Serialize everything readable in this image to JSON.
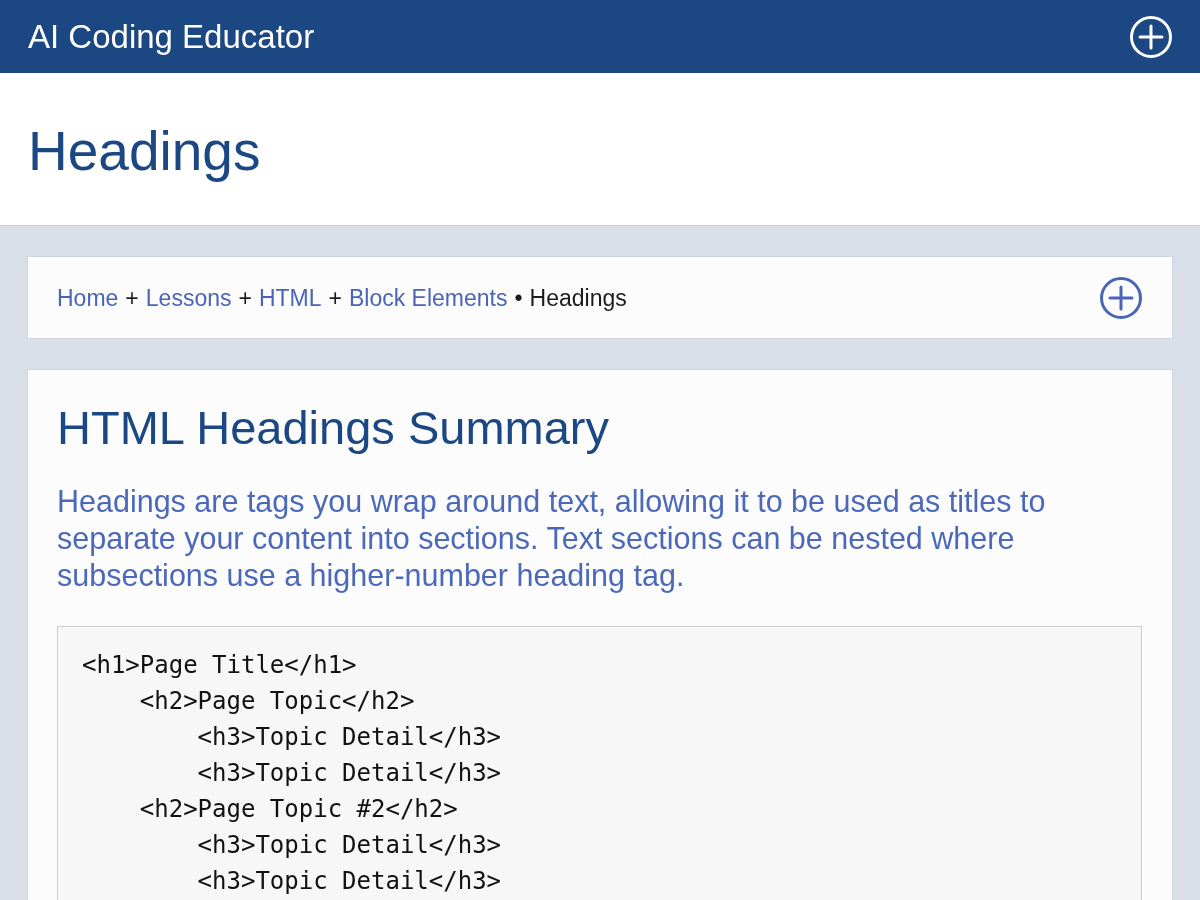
{
  "app_bar": {
    "title": "AI Coding Educator"
  },
  "page_title": "Headings",
  "breadcrumb": {
    "items": [
      {
        "label": "Home",
        "current": false,
        "separator": "+"
      },
      {
        "label": "Lessons",
        "current": false,
        "separator": "+"
      },
      {
        "label": "HTML",
        "current": false,
        "separator": "+"
      },
      {
        "label": "Block Elements",
        "current": false,
        "separator": "•"
      },
      {
        "label": "Headings",
        "current": true
      }
    ]
  },
  "summary": {
    "title": "HTML Headings Summary",
    "text": "Headings are tags you wrap around text, allowing it to be used as titles to separate your content into sections. Text sections can be nested where subsections use a higher-number heading tag.",
    "code_lines": [
      "<h1>Page Title</h1>",
      "    <h2>Page Topic</h2>",
      "        <h3>Topic Detail</h3>",
      "        <h3>Topic Detail</h3>",
      "    <h2>Page Topic #2</h2>",
      "        <h3>Topic Detail</h3>",
      "        <h3>Topic Detail</h3>"
    ]
  }
}
